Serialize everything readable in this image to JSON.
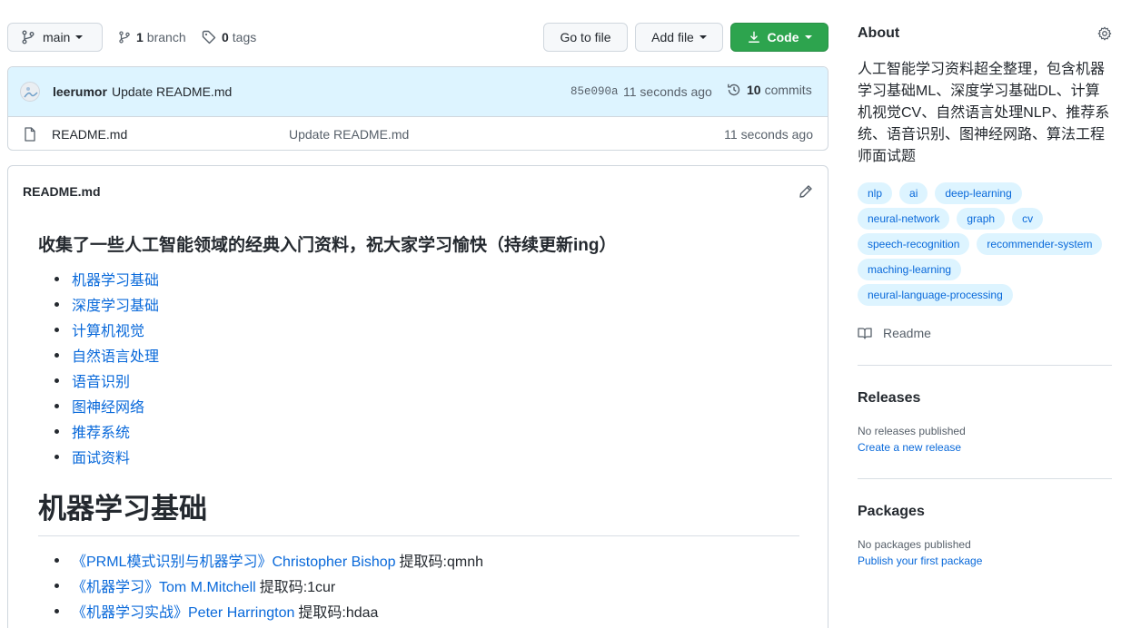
{
  "toolbar": {
    "branch_label": "main",
    "branches_count": "1",
    "branches_label": "branch",
    "tags_count": "0",
    "tags_label": "tags",
    "goto_label": "Go to file",
    "addfile_label": "Add file",
    "code_label": "Code"
  },
  "commit": {
    "author": "leerumor",
    "message": "Update README.md",
    "sha": "85e090a",
    "time": "11 seconds ago",
    "commits_count": "10",
    "commits_label": "commits"
  },
  "files": [
    {
      "name": "README.md",
      "message": "Update README.md",
      "time": "11 seconds ago"
    }
  ],
  "readme": {
    "header": "README.md",
    "intro_heading": "收集了一些人工智能领域的经典入门资料，祝大家学习愉快（持续更新ing）",
    "toc": [
      "机器学习基础",
      "深度学习基础",
      "计算机视觉",
      "自然语言处理",
      "语音识别",
      "图神经网络",
      "推荐系统",
      "面试资料"
    ],
    "section_heading": "机器学习基础",
    "books": [
      {
        "link": "《PRML模式识别与机器学习》Christopher Bishop",
        "code": "提取码:qmnh"
      },
      {
        "link": "《机器学习》Tom M.Mitchell",
        "code": "提取码:1cur"
      },
      {
        "link": "《机器学习实战》Peter Harrington",
        "code": "提取码:hdaa"
      }
    ]
  },
  "about": {
    "title": "About",
    "description": "人工智能学习资料超全整理，包含机器学习基础ML、深度学习基础DL、计算机视觉CV、自然语言处理NLP、推荐系统、语音识别、图神经网路、算法工程师面试题",
    "topics": [
      "nlp",
      "ai",
      "deep-learning",
      "neural-network",
      "graph",
      "cv",
      "speech-recognition",
      "recommender-system",
      "maching-learning",
      "neural-language-processing"
    ],
    "readme_label": "Readme"
  },
  "releases": {
    "title": "Releases",
    "empty_text": "No releases published",
    "create_link": "Create a new release"
  },
  "packages": {
    "title": "Packages",
    "empty_text": "No packages published",
    "publish_link": "Publish your first package"
  },
  "colors": {
    "link": "#0969da",
    "code_button": "#2da44e",
    "commit_row_bg": "#ddf4ff",
    "topic_bg": "#ddf4ff"
  }
}
